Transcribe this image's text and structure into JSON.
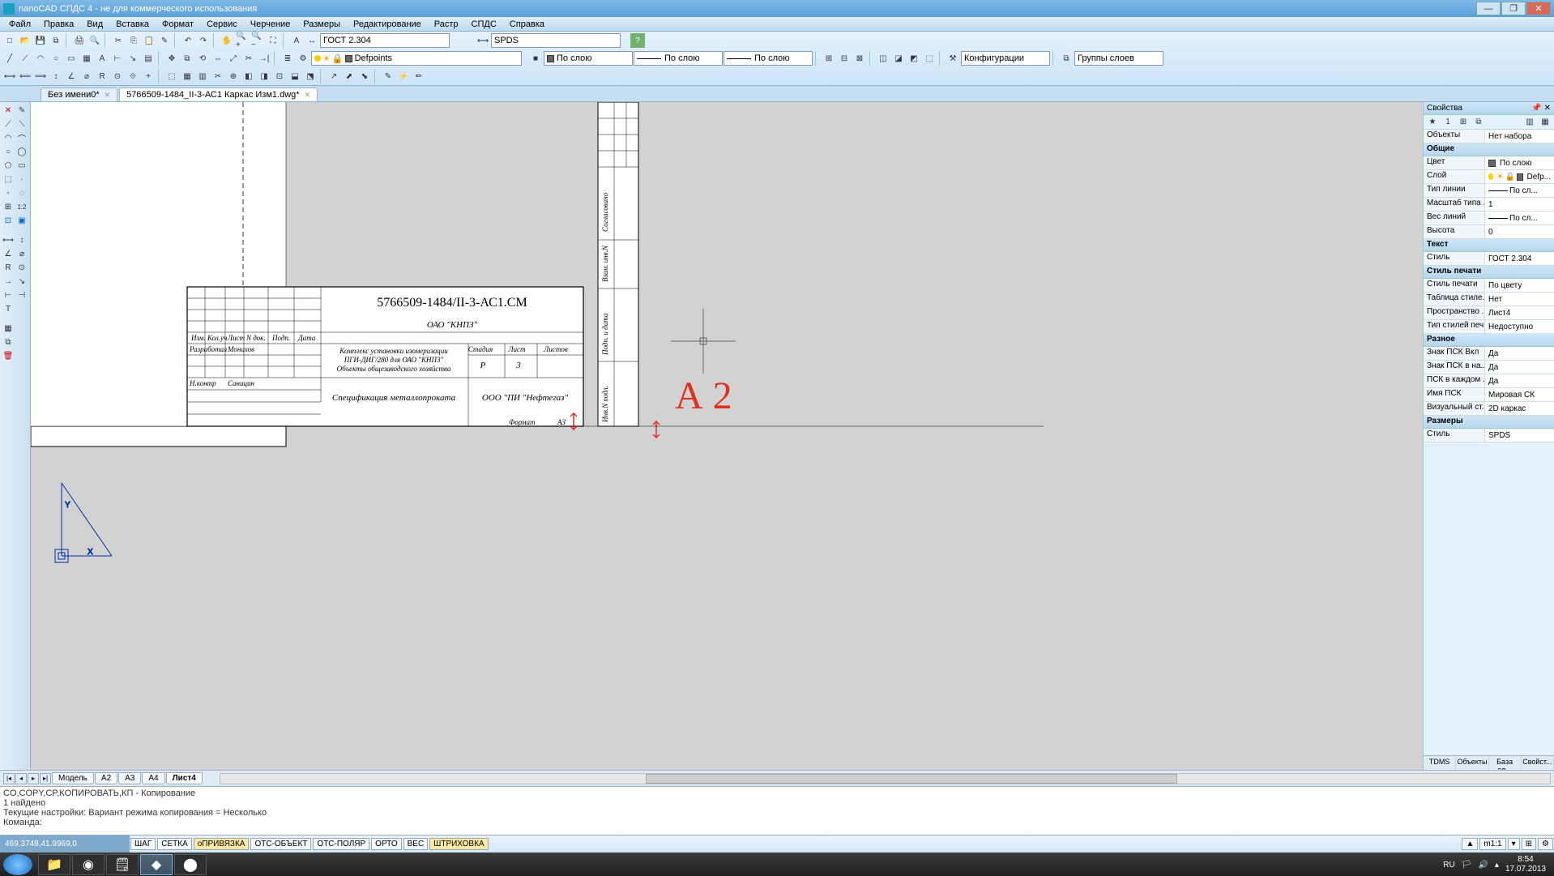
{
  "title": "nanoCAD СПДС 4 - не для коммерческого использования",
  "menu": [
    "Файл",
    "Правка",
    "Вид",
    "Вставка",
    "Формат",
    "Сервис",
    "Черчение",
    "Размеры",
    "Редактирование",
    "Растр",
    "СПДС",
    "Справка"
  ],
  "toolbar": {
    "text_style": "ГОСТ 2.304",
    "dim_style": "SPDS",
    "layer": "Defpoints",
    "linetype": "По слою",
    "lineweight": "По слою",
    "configs": "Конфигурации",
    "layer_groups": "Группы слоев"
  },
  "file_tabs": [
    {
      "label": "Без имени0*",
      "active": false
    },
    {
      "label": "5766509-1484_II-3-АС1 Каркас Изм1.dwg*",
      "active": true
    }
  ],
  "sheet_tabs": [
    "Модель",
    "А2",
    "А3",
    "А4",
    "Лист4"
  ],
  "sheet_active": "Лист4",
  "command": {
    "history1": "CO,COPY,CP,КОПИРОВАТЬ,КП - Копирование",
    "history2": "1 найдено",
    "history3": "Текущие настройки:  Вариант режима копирования = Несколько",
    "prompt": "Команда:"
  },
  "status": {
    "coords": "469.3748,41.9969,0",
    "toggles": [
      "ШАГ",
      "СЕТКА",
      "оПРИВЯЗКА",
      "ОТС-ОБЪЕКТ",
      "ОТС-ПОЛЯР",
      "ОРТО",
      "ВЕС",
      "ШТРИХОВКА"
    ],
    "toggle_state": [
      false,
      false,
      true,
      false,
      false,
      false,
      false,
      true
    ],
    "scale": "m1:1",
    "lang": "RU"
  },
  "properties": {
    "title": "Свойства",
    "objects_k": "Объекты",
    "objects_v": "Нет набора",
    "groups": {
      "general": "Общие",
      "text": "Текст",
      "plotstyle": "Стиль печати",
      "misc": "Разное",
      "dims": "Размеры"
    },
    "rows": [
      [
        "Цвет",
        "По слою"
      ],
      [
        "Слой",
        "Defp..."
      ],
      [
        "Тип линии",
        "По сл..."
      ],
      [
        "Масштаб типа ...",
        "1"
      ],
      [
        "Вес линий",
        "По сл..."
      ],
      [
        "Высота",
        "0"
      ]
    ],
    "text_rows": [
      [
        "Стиль",
        "ГОСТ 2.304"
      ]
    ],
    "plot_rows": [
      [
        "Стиль печати",
        "По цвету"
      ],
      [
        "Таблица стиле...",
        "Нет"
      ],
      [
        "Пространство ...",
        "Лист4"
      ],
      [
        "Тип стилей печ...",
        "Недоступно"
      ]
    ],
    "misc_rows": [
      [
        "Знак ПСК Вкл",
        "Да"
      ],
      [
        "Знак ПСК в на...",
        "Да"
      ],
      [
        "ПСК в каждом ...",
        "Да"
      ],
      [
        "Имя ПСК",
        "Мировая СК"
      ],
      [
        "Визуальный ст...",
        "2D каркас"
      ]
    ],
    "dim_rows": [
      [
        "Стиль",
        "SPDS"
      ]
    ],
    "bottom_tabs": [
      "TDMS",
      "Объекты",
      "База эл...",
      "Свойст..."
    ]
  },
  "drawing": {
    "main_num": "5766509-1484/II-3-АС1.СМ",
    "org": "ОАО \"КНПЗ\"",
    "desc1": "Комплекс установки изомеризации",
    "desc2": "ПГИ-ДИГ/280 для ОАО \"КНПЗ\"",
    "desc3": "Объекты общезаводского хозяйства",
    "spec": "Спецификация металлопроката",
    "designer": "ООО \"ПИ \"Нефтегаз\"",
    "hdr": {
      "izm": "Изм.",
      "kol": "Кол.уч",
      "list": "Лист",
      "ndok": "N док.",
      "podp": "Подп.",
      "data": "Дата"
    },
    "roles": {
      "dev": "Разработал",
      "devn": "Монахов",
      "check": "Н.контр",
      "checkn": "Синицин"
    },
    "shdr": {
      "stad": "Стадия",
      "list": "Лист",
      "listov": "Листов"
    },
    "sval": {
      "stad": "Р",
      "list": "3",
      "listov": ""
    },
    "format_k": "Формат",
    "format_v": "А3",
    "side1": "Согласовано",
    "side2": "Взам. инв.N",
    "side3": "Подп. и дата",
    "side4": "Инв.N подл.",
    "annotation": "А 2",
    "ucs_x": "X",
    "ucs_y": "Y"
  },
  "tray": {
    "time": "8:54",
    "date": "17.07.2013"
  }
}
